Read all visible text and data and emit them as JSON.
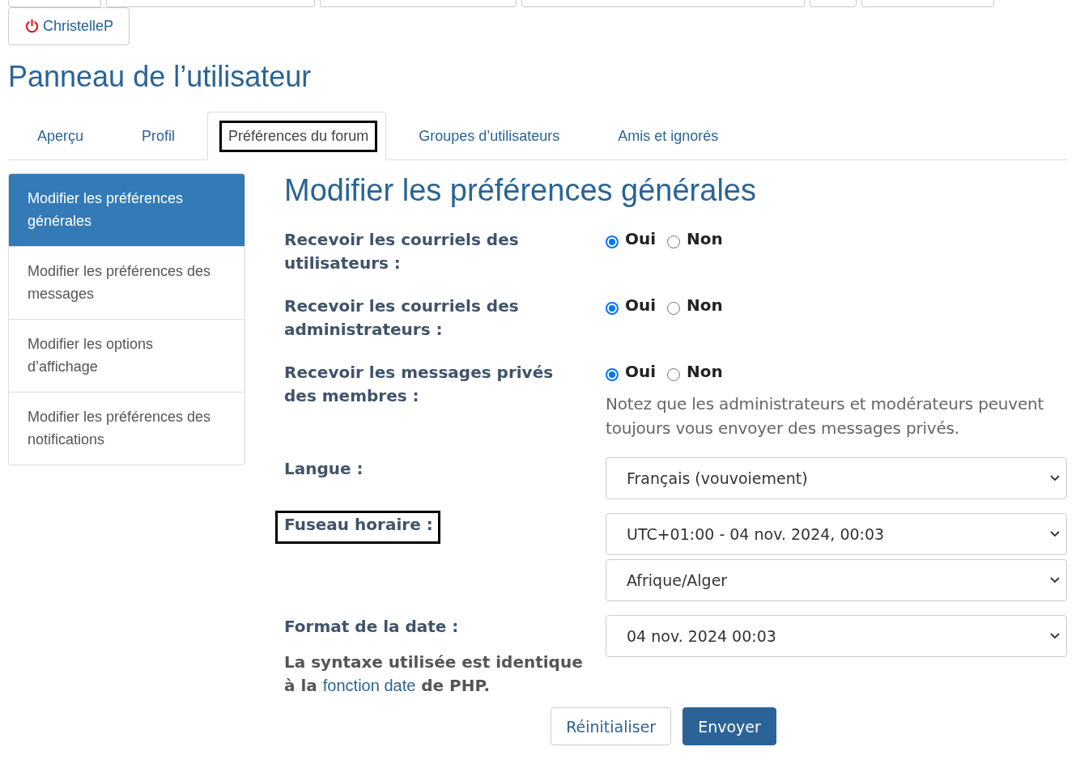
{
  "user_button": {
    "label": "ChristelleP"
  },
  "page_title": "Panneau de l’utilisateur",
  "tabs": [
    {
      "label": "Aperçu",
      "selected": false,
      "highlighted": false
    },
    {
      "label": "Profil",
      "selected": false,
      "highlighted": false
    },
    {
      "label": "Préférences du forum",
      "selected": true,
      "highlighted": true
    },
    {
      "label": "Groupes d’utilisateurs",
      "selected": false,
      "highlighted": false
    },
    {
      "label": "Amis et ignorés",
      "selected": false,
      "highlighted": false
    }
  ],
  "sidebar": {
    "items": [
      {
        "label": "Modifier les préférences générales",
        "selected": true
      },
      {
        "label": "Modifier les préférences des messages",
        "selected": false
      },
      {
        "label": "Modifier les options d’affichage",
        "selected": false
      },
      {
        "label": "Modifier les préférences des notifications",
        "selected": false
      }
    ]
  },
  "section_title": "Modifier les préférences générales",
  "settings": [
    {
      "kind": "radio",
      "label": "Recevoir les courriels des utilisateurs :",
      "highlighted": false,
      "options": [
        {
          "label": "Oui",
          "selected": true
        },
        {
          "label": "Non",
          "selected": false
        }
      ]
    },
    {
      "kind": "radio",
      "label": "Recevoir les courriels des administrateurs :",
      "highlighted": false,
      "options": [
        {
          "label": "Oui",
          "selected": true
        },
        {
          "label": "Non",
          "selected": false
        }
      ]
    },
    {
      "kind": "radio",
      "label": "Recevoir les messages privés des membres :",
      "highlighted": false,
      "options": [
        {
          "label": "Oui",
          "selected": true
        },
        {
          "label": "Non",
          "selected": false
        }
      ],
      "note": "Notez que les administrateurs et modérateurs peuvent toujours vous envoyer des messages privés."
    },
    {
      "kind": "select",
      "label": "Langue :",
      "highlighted": false,
      "selects": [
        "Français (vouvoiement)"
      ]
    },
    {
      "kind": "select",
      "label": "Fuseau horaire :",
      "highlighted": true,
      "selects": [
        "UTC+01:00 - 04 nov. 2024, 00:03",
        "Afrique/Alger"
      ]
    },
    {
      "kind": "select",
      "label": "Format de la date :",
      "highlighted": false,
      "selects": [
        "04 nov. 2024 00:03"
      ],
      "help": {
        "before": "La syntaxe utilisée est identique à la",
        "link": "fonction date",
        "after": "de PHP."
      }
    }
  ],
  "buttons": [
    {
      "label": "Réinitialiser",
      "kind": "secondary"
    },
    {
      "label": "Envoyer",
      "kind": "primary"
    }
  ]
}
